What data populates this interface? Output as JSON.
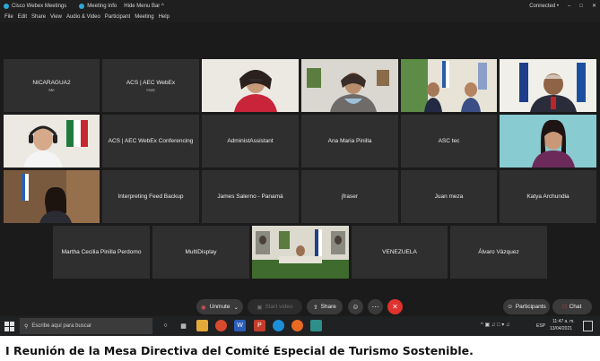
{
  "titlebar": {
    "app": "Cisco Webex Meetings",
    "meeting_info": "Meeting Info",
    "hide_menu": "Hide Menu Bar ^",
    "status": "Connected •"
  },
  "menu": [
    "File",
    "Edit",
    "Share",
    "View",
    "Audio & Video",
    "Participant",
    "Meeting",
    "Help"
  ],
  "tiles": {
    "nicaragua2": {
      "name": "NICARAGUA2",
      "sub": "Me"
    },
    "acs_host": {
      "name": "ACS | AEC WebEx",
      "sub": "Host"
    },
    "acs_conf": {
      "name": "ACS | AEC WebEx Conferencing"
    },
    "admin": {
      "name": "AdministAssistant"
    },
    "ana": {
      "name": "Ana Maria Pinilla"
    },
    "asc": {
      "name": "ASC tec"
    },
    "interp": {
      "name": "Interpreting Feed Backup"
    },
    "james": {
      "name": "James Salerno - Panamá"
    },
    "jfraser": {
      "name": "jfraser"
    },
    "juan": {
      "name": "Juan meza"
    },
    "katya": {
      "name": "Katya Archundia"
    },
    "martha": {
      "name": "Martha Cecilia Pinilla Perdomo"
    },
    "multi": {
      "name": "MultiDisplay"
    },
    "venezuela": {
      "name": "VENEZUELA"
    },
    "alvaro": {
      "name": "Álvaro Vázquez"
    }
  },
  "toolbar": {
    "unmute": "Unmute",
    "start_video": "Start video",
    "share": "Share",
    "participants": "Participants",
    "chat": "Chat"
  },
  "taskbar": {
    "search_placeholder": "Escribe aquí para buscar",
    "lang": "ESP",
    "time": "11:47 a. m.",
    "date": "13/04/2021"
  },
  "caption": "I Reunión de la Mesa Directiva del Comité Especial de Turismo Sostenible."
}
